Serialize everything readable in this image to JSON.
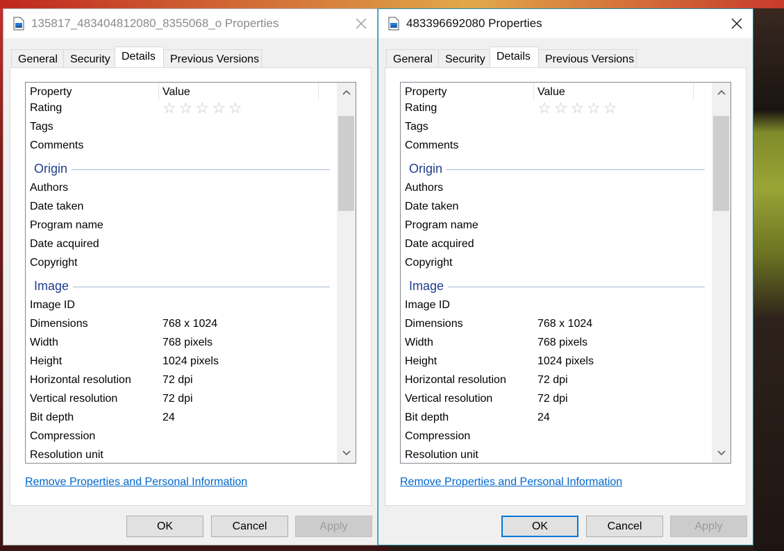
{
  "windows": [
    {
      "title": "135817_483404812080_8355068_o Properties",
      "tabs": [
        "General",
        "Security",
        "Details",
        "Previous Versions"
      ],
      "active_tab": "Details",
      "columns": {
        "property": "Property",
        "value": "Value"
      },
      "rating_stars": "☆☆☆☆☆",
      "rows": {
        "rating": "Rating",
        "tags": "Tags",
        "comments": "Comments",
        "origin": "Origin",
        "authors": "Authors",
        "date_taken": "Date taken",
        "program_name": "Program name",
        "date_acquired": "Date acquired",
        "copyright": "Copyright",
        "image": "Image",
        "image_id": "Image ID",
        "dimensions": "Dimensions",
        "dimensions_val": "768 x 1024",
        "width": "Width",
        "width_val": "768 pixels",
        "height": "Height",
        "height_val": "1024 pixels",
        "hres": "Horizontal resolution",
        "hres_val": "72 dpi",
        "vres": "Vertical resolution",
        "vres_val": "72 dpi",
        "bitdepth": "Bit depth",
        "bitdepth_val": "24",
        "compression": "Compression",
        "resunit": "Resolution unit"
      },
      "link": "Remove Properties and Personal Information",
      "buttons": {
        "ok": "OK",
        "cancel": "Cancel",
        "apply": "Apply"
      },
      "focused": false
    },
    {
      "title": "483396692080 Properties",
      "tabs": [
        "General",
        "Security",
        "Details",
        "Previous Versions"
      ],
      "active_tab": "Details",
      "columns": {
        "property": "Property",
        "value": "Value"
      },
      "rating_stars": "☆☆☆☆☆",
      "rows": {
        "rating": "Rating",
        "tags": "Tags",
        "comments": "Comments",
        "origin": "Origin",
        "authors": "Authors",
        "date_taken": "Date taken",
        "program_name": "Program name",
        "date_acquired": "Date acquired",
        "copyright": "Copyright",
        "image": "Image",
        "image_id": "Image ID",
        "dimensions": "Dimensions",
        "dimensions_val": "768 x 1024",
        "width": "Width",
        "width_val": "768 pixels",
        "height": "Height",
        "height_val": "1024 pixels",
        "hres": "Horizontal resolution",
        "hres_val": "72 dpi",
        "vres": "Vertical resolution",
        "vres_val": "72 dpi",
        "bitdepth": "Bit depth",
        "bitdepth_val": "24",
        "compression": "Compression",
        "resunit": "Resolution unit"
      },
      "link": "Remove Properties and Personal Information",
      "buttons": {
        "ok": "OK",
        "cancel": "Cancel",
        "apply": "Apply"
      },
      "focused": true
    }
  ],
  "colors": {
    "group_heading": "#1e3d8c",
    "link": "#0066cc",
    "focus_border": "#0078d7",
    "active_window_border": "#1e8fa6"
  },
  "icons": {
    "title_icon": "image-file-icon",
    "close": "close-icon",
    "scroll_up": "chevron-up-icon",
    "scroll_down": "chevron-down-icon",
    "rating": "star-icon"
  }
}
